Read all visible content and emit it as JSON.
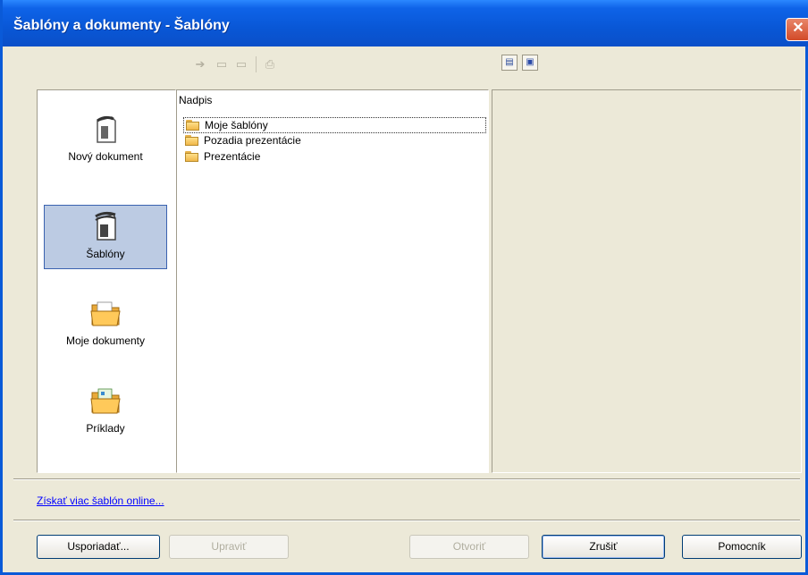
{
  "window": {
    "title": "Šablóny a dokumenty - Šablóny",
    "close_glyph": "✕"
  },
  "toolbar": {
    "back_icon": "back-arrow-icon",
    "folder_up_icon": "folder-up-icon",
    "print_icon": "print-icon",
    "view_buttons": [
      {
        "name": "document-view-icon",
        "glyph": "▤"
      },
      {
        "name": "preview-view-icon",
        "glyph": "▣"
      }
    ]
  },
  "nav": {
    "items": [
      {
        "label": "Nový dokument",
        "icon": "new-document-icon"
      },
      {
        "label": "Šablóny",
        "icon": "templates-icon",
        "selected": true
      },
      {
        "label": "Moje dokumenty",
        "icon": "my-documents-folder-icon"
      },
      {
        "label": "Príklady",
        "icon": "examples-folder-icon"
      }
    ]
  },
  "list": {
    "header": "Nadpis",
    "rows": [
      {
        "label": "Moje šablóny",
        "icon": "folder-icon"
      },
      {
        "label": "Pozadia prezentácie",
        "icon": "folder-icon"
      },
      {
        "label": "Prezentácie",
        "icon": "folder-icon"
      }
    ]
  },
  "online_link": "Získať viac šablón online...",
  "buttons": {
    "organize": "Usporiadať...",
    "edit": "Upraviť",
    "open": "Otvoriť",
    "cancel": "Zrušiť",
    "help": "Pomocník"
  },
  "colors": {
    "titlebar": "#0a5ad8",
    "selection": "#bccbe3",
    "dialog": "#ece9d8",
    "link": "#0000ff"
  }
}
